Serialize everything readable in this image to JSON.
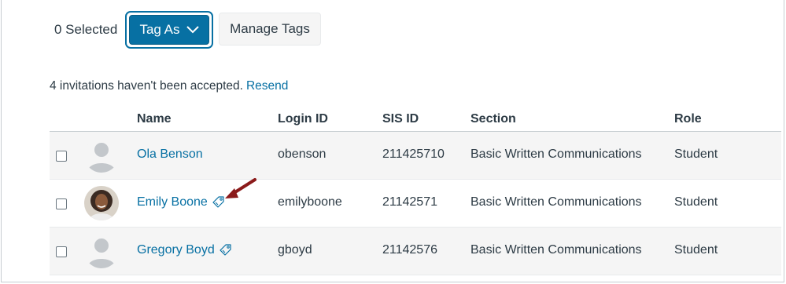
{
  "toolbar": {
    "selected_label": "0 Selected",
    "tag_as_label": "Tag As",
    "manage_tags_label": "Manage Tags"
  },
  "invitations": {
    "text": "4 invitations haven't been accepted.",
    "resend_label": "Resend"
  },
  "table": {
    "headers": {
      "name": "Name",
      "login_id": "Login ID",
      "sis_id": "SIS ID",
      "section": "Section",
      "role": "Role"
    },
    "rows": [
      {
        "name": "Ola Benson",
        "login_id": "obenson",
        "sis_id": "211425710",
        "section": "Basic Written Communications",
        "role": "Student",
        "avatar": "default-avatar",
        "tag_icon": false
      },
      {
        "name": "Emily Boone",
        "login_id": "emilyboone",
        "sis_id": "21142571",
        "section": "Basic Written Communications",
        "role": "Student",
        "avatar": "photo-avatar",
        "tag_icon": true
      },
      {
        "name": "Gregory Boyd",
        "login_id": "gboyd",
        "sis_id": "21142576",
        "section": "Basic Written Communications",
        "role": "Student",
        "avatar": "default-avatar",
        "tag_icon": true
      }
    ]
  },
  "colors": {
    "primary": "#0770a3",
    "text": "#2d3b45",
    "row_alt": "#f5f5f5",
    "annotation_arrow": "#8b1a1a"
  }
}
